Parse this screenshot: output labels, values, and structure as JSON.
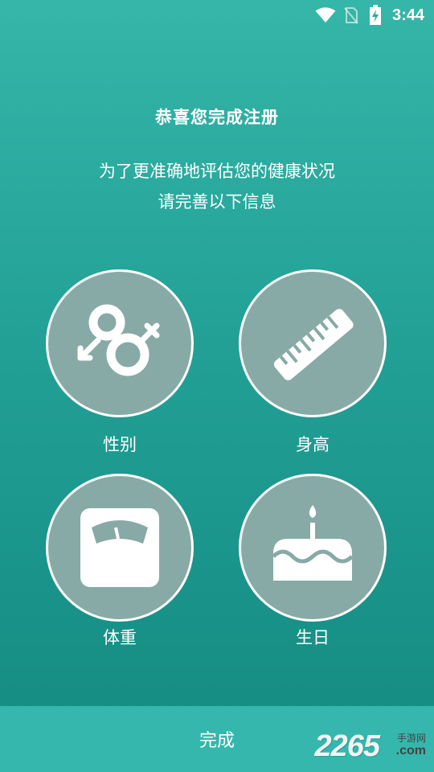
{
  "status_bar": {
    "time": "3:44",
    "icons": [
      "wifi-icon",
      "no-sim-icon",
      "battery-charging-icon"
    ]
  },
  "header": {
    "title": "恭喜您完成注册",
    "subtitle_line1": "为了更准确地评估您的健康状况",
    "subtitle_line2": "请完善以下信息"
  },
  "options": {
    "gender": {
      "label": "性别",
      "icon": "gender-icon"
    },
    "height": {
      "label": "身高",
      "icon": "ruler-icon"
    },
    "weight": {
      "label": "体重",
      "icon": "scale-icon"
    },
    "birthday": {
      "label": "生日",
      "icon": "birthday-cake-icon"
    }
  },
  "footer": {
    "done_label": "完成"
  },
  "watermark": {
    "number": "2265",
    "cn": "手游网",
    "domain": ".com"
  },
  "colors": {
    "background_top": "#35b6a8",
    "background_bottom": "#138a80",
    "circle_fill": "#87aaa6",
    "footer_bar": "#35b7ad"
  }
}
